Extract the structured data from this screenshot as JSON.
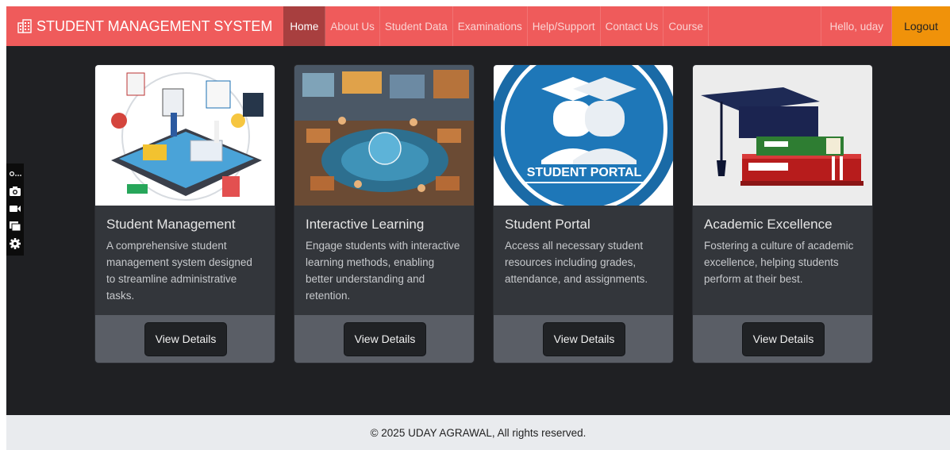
{
  "brand": {
    "title": "STUDENT MANAGEMENT SYSTEM",
    "icon": "building-icon"
  },
  "nav": {
    "items": [
      {
        "label": "Home",
        "active": true
      },
      {
        "label": "About Us",
        "active": false
      },
      {
        "label": "Student Data",
        "active": false
      },
      {
        "label": "Examinations",
        "active": false
      },
      {
        "label": "Help/Support",
        "active": false
      },
      {
        "label": "Contact Us",
        "active": false
      },
      {
        "label": "Course",
        "active": false
      }
    ],
    "greeting": "Hello, uday",
    "logout_label": "Logout"
  },
  "side_toolbar": [
    "pin-icon",
    "camera-icon",
    "video-icon",
    "window-icon",
    "gear-icon"
  ],
  "cards": [
    {
      "title": "Student Management",
      "text": "A comprehensive student management system designed to streamline administrative tasks.",
      "button": "View Details"
    },
    {
      "title": "Interactive Learning",
      "text": "Engage students with interactive learning methods, enabling better understanding and retention.",
      "button": "View Details"
    },
    {
      "title": "Student Portal",
      "text": "Access all necessary student resources including grades, attendance, and assignments.",
      "button": "View Details",
      "image_text": "STUDENT PORTAL"
    },
    {
      "title": "Academic Excellence",
      "text": "Fostering a culture of academic excellence, helping students perform at their best.",
      "button": "View Details"
    }
  ],
  "footer": {
    "text": "© 2025 UDAY AGRAWAL, All rights reserved."
  },
  "colors": {
    "navbar": "#ef5b5b",
    "active_nav": "#a83f3f",
    "logout": "#f0920a",
    "page_bg": "#1f2023",
    "card_bg": "#33363b",
    "card_footer": "#5a5e66"
  }
}
